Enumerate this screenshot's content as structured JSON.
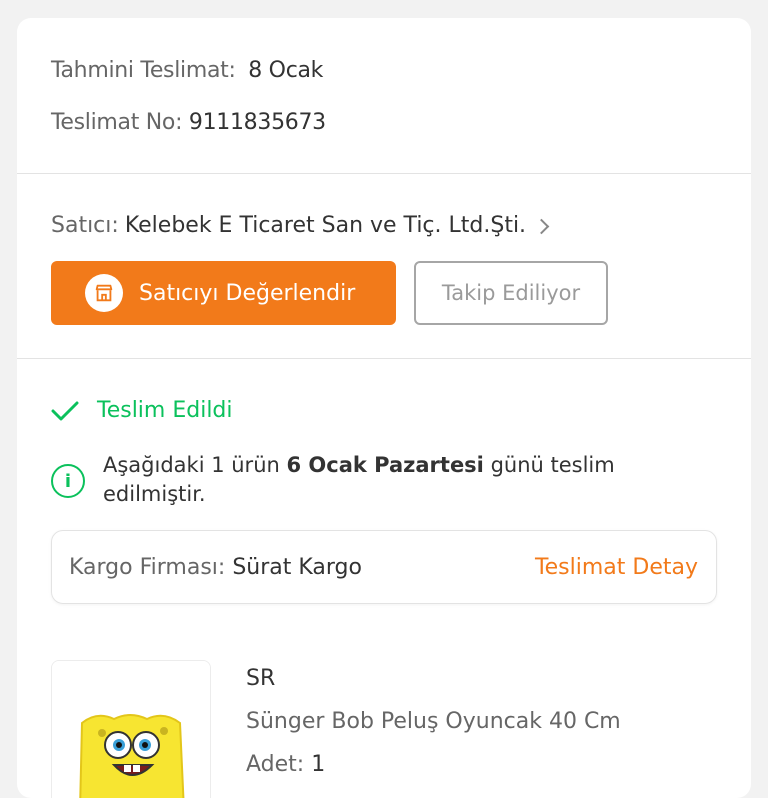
{
  "delivery": {
    "estimate_label": "Tahmini Teslimat:",
    "estimate_value": "8 Ocak",
    "number_label": "Teslimat No:",
    "number_value": "9111835673"
  },
  "seller": {
    "label": "Satıcı:",
    "name": "Kelebek E Ticaret San ve Tiç. Ltd.Şti.",
    "rate_button": "Satıcıyı Değerlendir",
    "follow_button": "Takip Ediliyor"
  },
  "status": {
    "text": "Teslim Edildi",
    "info_prefix": "Aşağıdaki 1 ürün ",
    "info_date": "6 Ocak Pazartesi",
    "info_suffix": " günü teslim edilmiştir."
  },
  "cargo": {
    "label": "Kargo Firması:",
    "company": "Sürat Kargo",
    "detail_link": "Teslimat Detay"
  },
  "product": {
    "brand": "SR",
    "name": "Sünger Bob Peluş Oyuncak 40 Cm",
    "qty_label": "Adet:",
    "qty_value": "1"
  },
  "colors": {
    "accent": "#f27a1a",
    "success": "#0bc15c"
  },
  "icons": [
    "store-icon",
    "chevron-right-icon",
    "check-icon",
    "info-icon"
  ]
}
